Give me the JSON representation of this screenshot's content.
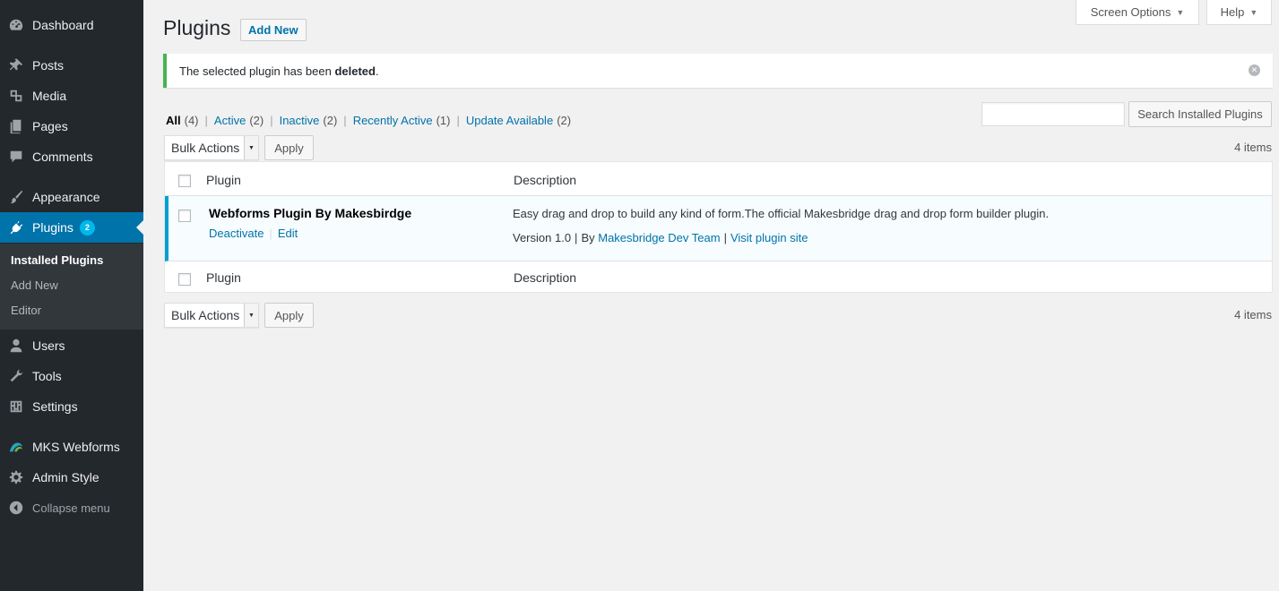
{
  "sidebar": {
    "items": [
      {
        "label": "Dashboard",
        "icon": "dashboard-icon"
      },
      {
        "label": "Posts",
        "icon": "pin-icon"
      },
      {
        "label": "Media",
        "icon": "media-icon"
      },
      {
        "label": "Pages",
        "icon": "pages-icon"
      },
      {
        "label": "Comments",
        "icon": "comment-icon"
      },
      {
        "label": "Appearance",
        "icon": "brush-icon"
      },
      {
        "label": "Plugins",
        "icon": "plugin-icon",
        "badge": "2",
        "current": true
      },
      {
        "label": "Users",
        "icon": "user-icon"
      },
      {
        "label": "Tools",
        "icon": "wrench-icon"
      },
      {
        "label": "Settings",
        "icon": "settings-icon"
      },
      {
        "label": "MKS Webforms",
        "icon": "mks-logo-icon"
      },
      {
        "label": "Admin Style",
        "icon": "gear-icon"
      }
    ],
    "submenu": [
      "Installed Plugins",
      "Add New",
      "Editor"
    ],
    "collapse_label": "Collapse menu"
  },
  "header": {
    "screen_options": "Screen Options",
    "help": "Help",
    "title": "Plugins",
    "add_new": "Add New"
  },
  "notice": {
    "text_before": "The selected plugin has been ",
    "text_bold": "deleted",
    "text_after": "."
  },
  "filters": [
    {
      "label": "All",
      "count": "(4)",
      "current": true
    },
    {
      "label": "Active",
      "count": "(2)"
    },
    {
      "label": "Inactive",
      "count": "(2)"
    },
    {
      "label": "Recently Active",
      "count": "(1)"
    },
    {
      "label": "Update Available",
      "count": "(2)"
    }
  ],
  "search": {
    "placeholder": "",
    "button": "Search Installed Plugins"
  },
  "bulk": {
    "label": "Bulk Actions",
    "apply": "Apply",
    "items_count": "4 items"
  },
  "table": {
    "columns": [
      "Plugin",
      "Description"
    ],
    "rows": [
      {
        "name": "Webforms Plugin By Makesbirdge",
        "actions": [
          "Deactivate",
          "Edit"
        ],
        "description": "Easy drag and drop to build any kind of form.The official Makesbridge drag and drop form builder plugin.",
        "version": "Version 1.0",
        "by": "By",
        "author": "Makesbridge Dev Team",
        "site": "Visit plugin site"
      }
    ]
  },
  "colors": {
    "sidebar_bg": "#23282d",
    "accent": "#0073aa",
    "notice_success": "#46b450",
    "active_plugin_border": "#00a0d2",
    "badge": "#00b9eb"
  }
}
